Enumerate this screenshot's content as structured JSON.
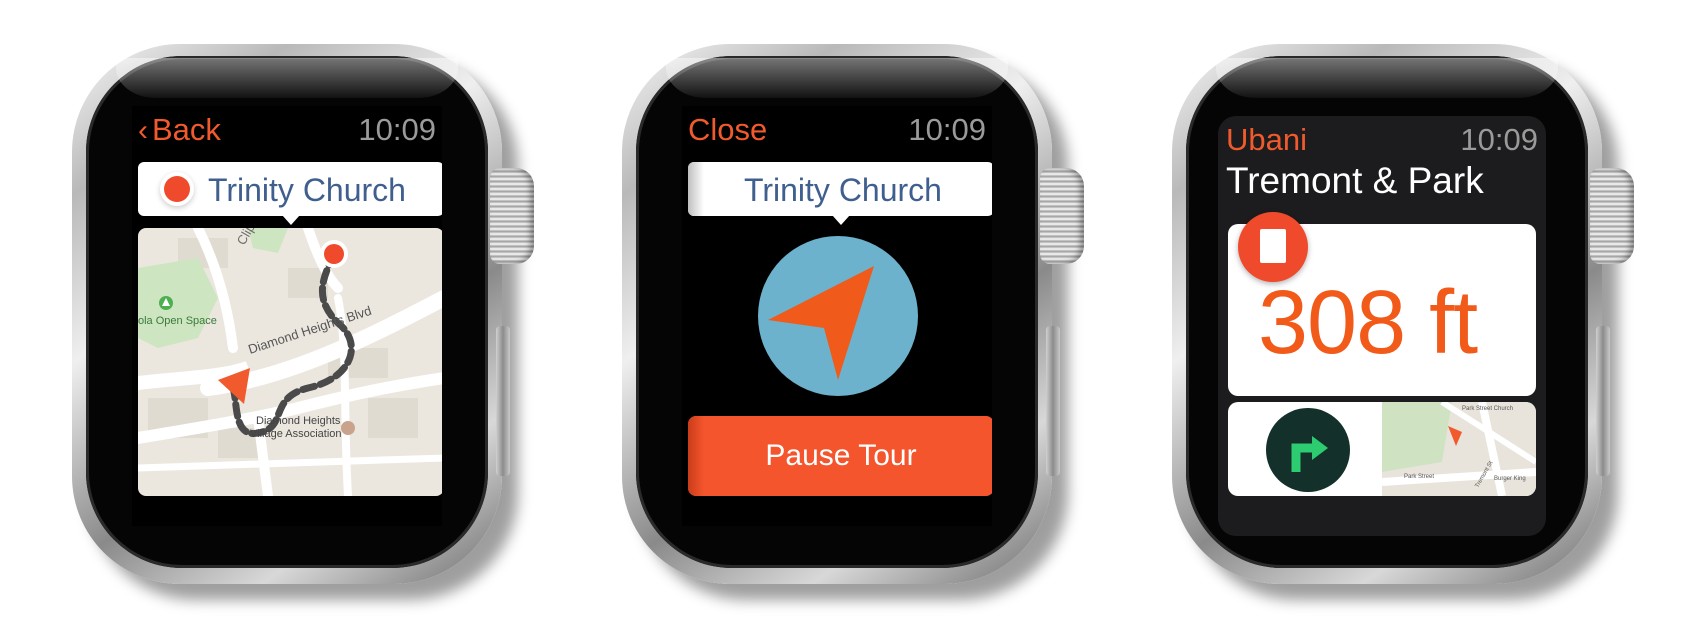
{
  "watch1": {
    "back_label": "Back",
    "time": "10:09",
    "destination": "Trinity Church",
    "map_labels": {
      "street_top": "Clipp",
      "park": "ola Open Space",
      "street_main": "Diamond Heights Blvd",
      "poi_line1": "Diamond Heights",
      "poi_line2": "Village Association"
    }
  },
  "watch2": {
    "close_label": "Close",
    "time": "10:09",
    "destination": "Trinity Church",
    "pause_label": "Pause Tour"
  },
  "watch3": {
    "app_name": "Ubani",
    "time": "10:09",
    "title": "Tremont & Park",
    "distance": "308 ft",
    "map_labels": {
      "street1": "Park Street Church",
      "street2": "Park Street",
      "street3": "Tremont St",
      "poi": "Burger King"
    }
  },
  "colors": {
    "accent": "#f05a2c",
    "callout_text": "#3f5f8e",
    "compass_bg": "#6db2cc",
    "distance": "#f25a19",
    "turn_icon_bg": "#13302a",
    "turn_icon_arrow": "#2ecc71"
  }
}
